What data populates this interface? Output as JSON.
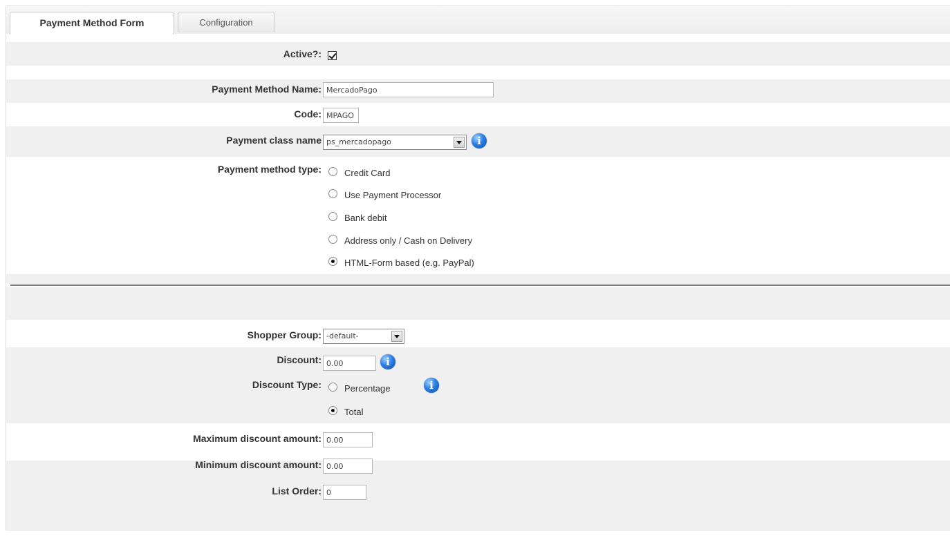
{
  "tabs": [
    {
      "label": "Payment Method Form",
      "active": true
    },
    {
      "label": "Configuration",
      "active": false
    }
  ],
  "form": {
    "active_label": "Active?:",
    "active_checked": true,
    "name_label": "Payment Method Name:",
    "name_value": "MercadoPago",
    "code_label": "Code:",
    "code_value": "MPAGO",
    "class_label": "Payment class name",
    "class_value": "ps_mercadopago",
    "type_label": "Payment method type:",
    "type_options": [
      {
        "label": "Credit Card",
        "selected": false
      },
      {
        "label": "Use Payment Processor",
        "selected": false
      },
      {
        "label": "Bank debit",
        "selected": false
      },
      {
        "label": "Address only / Cash on Delivery",
        "selected": false
      },
      {
        "label": "HTML-Form based (e.g. PayPal)",
        "selected": true
      }
    ],
    "shopper_label": "Shopper Group:",
    "shopper_value": "-default-",
    "discount_label": "Discount:",
    "discount_value": "0.00",
    "discount_type_label": "Discount Type:",
    "discount_type_options": [
      {
        "label": "Percentage",
        "selected": false
      },
      {
        "label": "Total",
        "selected": true
      }
    ],
    "max_label": "Maximum discount amount:",
    "max_value": "0.00",
    "min_label": "Minimum discount amount:",
    "min_value": "0.00",
    "order_label": "List Order:",
    "order_value": "0"
  },
  "icons": {
    "info": "info-icon",
    "info_glyph": "i"
  }
}
